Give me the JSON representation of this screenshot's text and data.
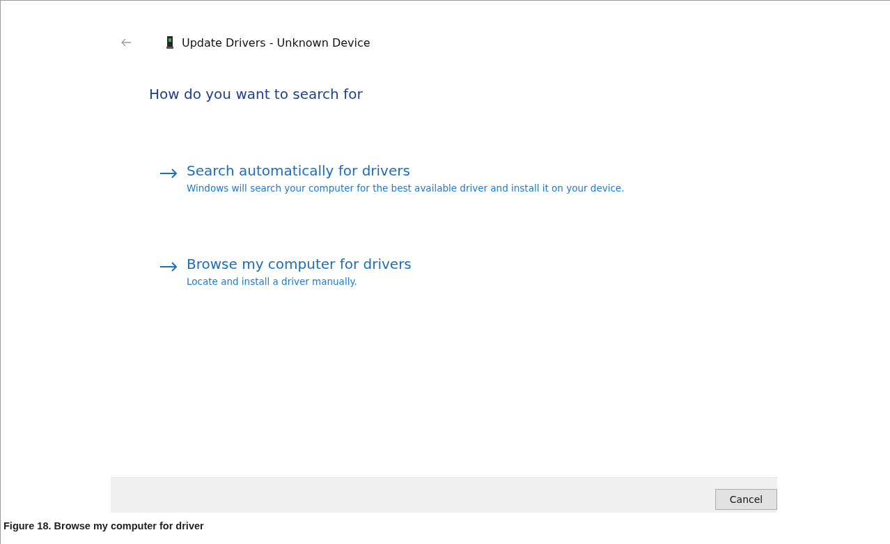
{
  "window": {
    "title": "Update Drivers - Unknown Device"
  },
  "heading": "How do you want to search for",
  "options": [
    {
      "title": "Search automatically for drivers",
      "description": "Windows will search your computer for the best available driver and install it on your device."
    },
    {
      "title": "Browse my computer for drivers",
      "description": "Locate and install a driver manually."
    }
  ],
  "buttons": [
    "Cancel"
  ],
  "caption": "Figure 18.  Browse my computer for driver"
}
